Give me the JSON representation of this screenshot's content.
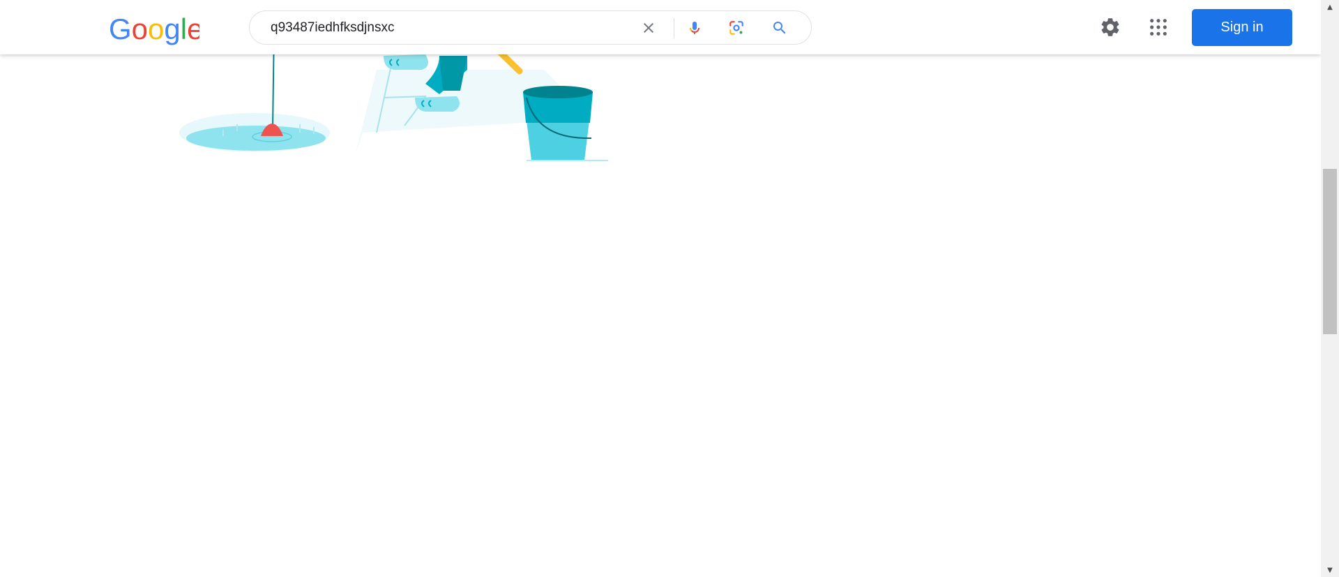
{
  "header": {
    "logo_text": "Google",
    "search": {
      "value": "q93487iedhfksdjnsxc",
      "placeholder": ""
    },
    "icons": {
      "clear": "close-icon",
      "mic": "microphone-icon",
      "lens": "google-lens-icon",
      "search": "search-icon",
      "settings": "gear-icon",
      "apps": "apps-grid-icon"
    },
    "sign_in_label": "Sign in"
  },
  "colors": {
    "brand_blue": "#1a73e8",
    "google_blue": "#4285f4",
    "google_red": "#ea4335",
    "google_yellow": "#fbbc05",
    "google_green": "#34a853",
    "illustration_teal": "#00acc1",
    "illustration_light": "#8ee3ef"
  },
  "scrollbar": {
    "up_arrow": "▲",
    "down_arrow": "▼"
  }
}
